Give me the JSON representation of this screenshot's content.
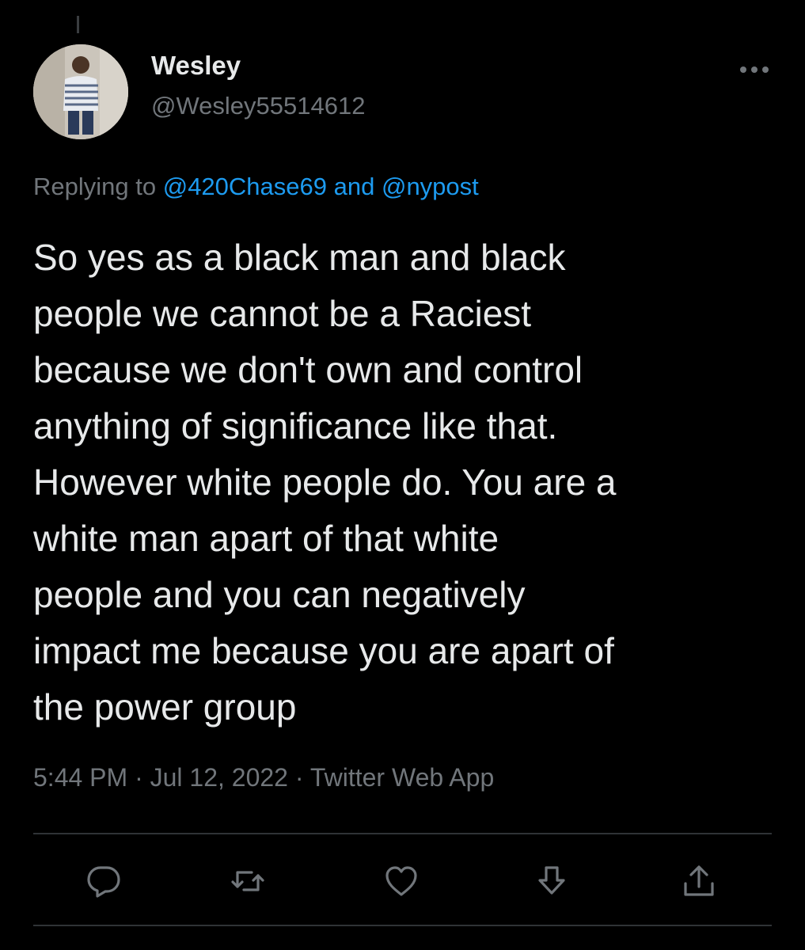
{
  "tweet": {
    "display_name": "Wesley",
    "handle": "@Wesley55514612",
    "reply_prefix": "Replying to ",
    "reply_mention_1": "@420Chase69",
    "reply_and": " and ",
    "reply_mention_2": "@nypost",
    "text": "So yes as a black man and black\npeople we cannot be a Raciest\nbecause we don't own and control\nanything of significance like that.\nHowever white people do. You are a\nwhite man apart of that white\npeople and you can negatively\nimpact me because you are apart of\nthe power group",
    "time": "5:44 PM",
    "separator": " · ",
    "date": "Jul 12, 2022",
    "source": "Twitter Web App"
  },
  "icons": {
    "more": "more-horizontal-icon",
    "reply": "reply-icon",
    "retweet": "retweet-icon",
    "like": "like-icon",
    "bookmark": "bookmark-icon",
    "share": "share-icon"
  },
  "colors": {
    "background": "#000000",
    "text": "#e7e9ea",
    "secondary": "#71767b",
    "accent": "#1d9bf0",
    "divider": "#2f3336"
  }
}
